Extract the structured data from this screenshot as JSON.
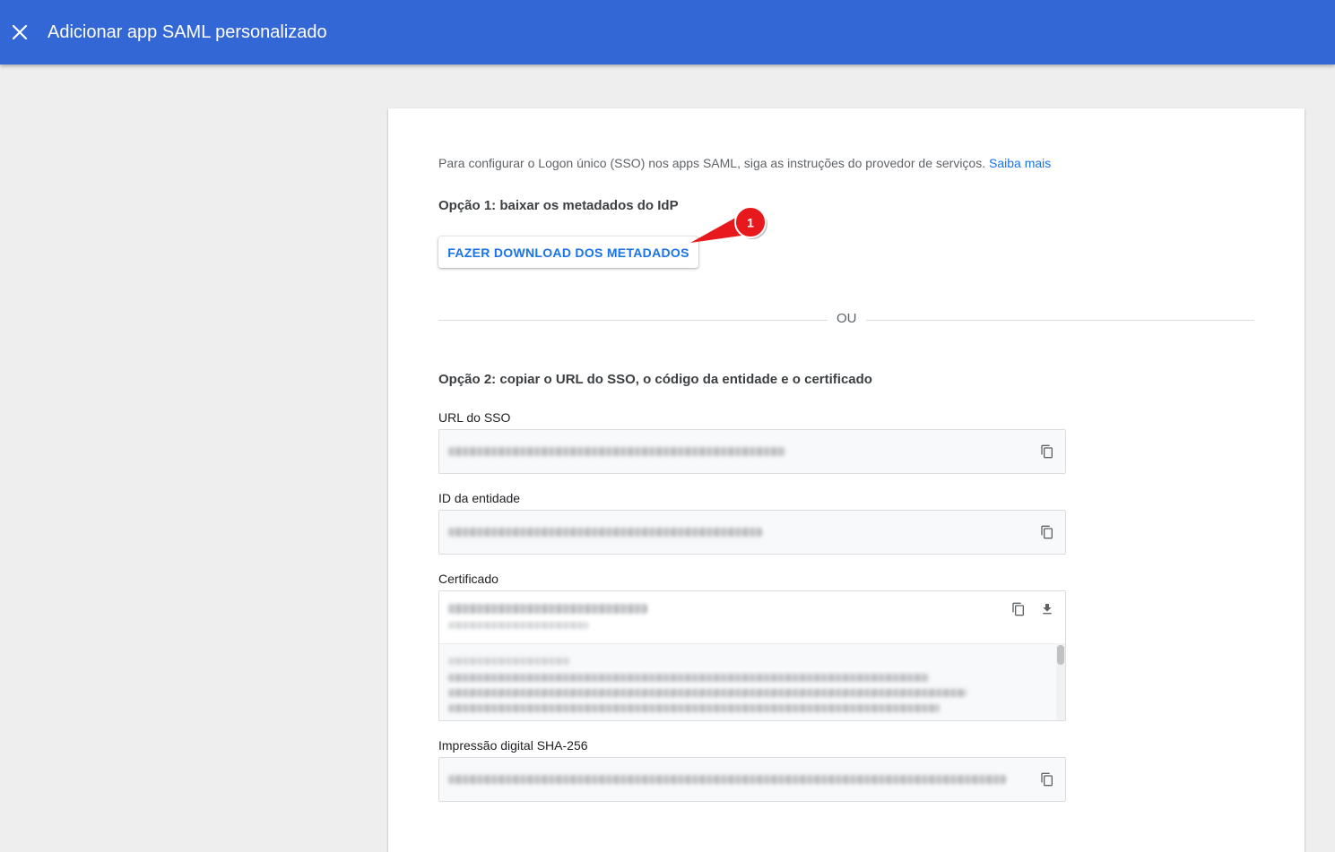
{
  "header": {
    "title": "Adicionar app SAML personalizado",
    "close_icon": "close-icon"
  },
  "colors": {
    "appbar": "#3367d6",
    "link": "#1a73e8",
    "annotation": "#e8191c"
  },
  "main": {
    "intro_text": "Para configurar o Logon único (SSO) nos apps SAML, siga as instruções do provedor de serviços.",
    "learn_more": "Saiba mais",
    "option1_title": "Opção 1: baixar os metadados do IdP",
    "download_button": "FAZER DOWNLOAD DOS METADADOS",
    "or_label": "OU",
    "option2_title": "Opção 2: copiar o URL do SSO, o código da entidade e o certificado",
    "fields": {
      "sso_url_label": "URL do SSO",
      "entity_id_label": "ID da entidade",
      "certificate_label": "Certificado",
      "fingerprint_label": "Impressão digital SHA-256"
    }
  },
  "annotation": {
    "number": "1"
  }
}
